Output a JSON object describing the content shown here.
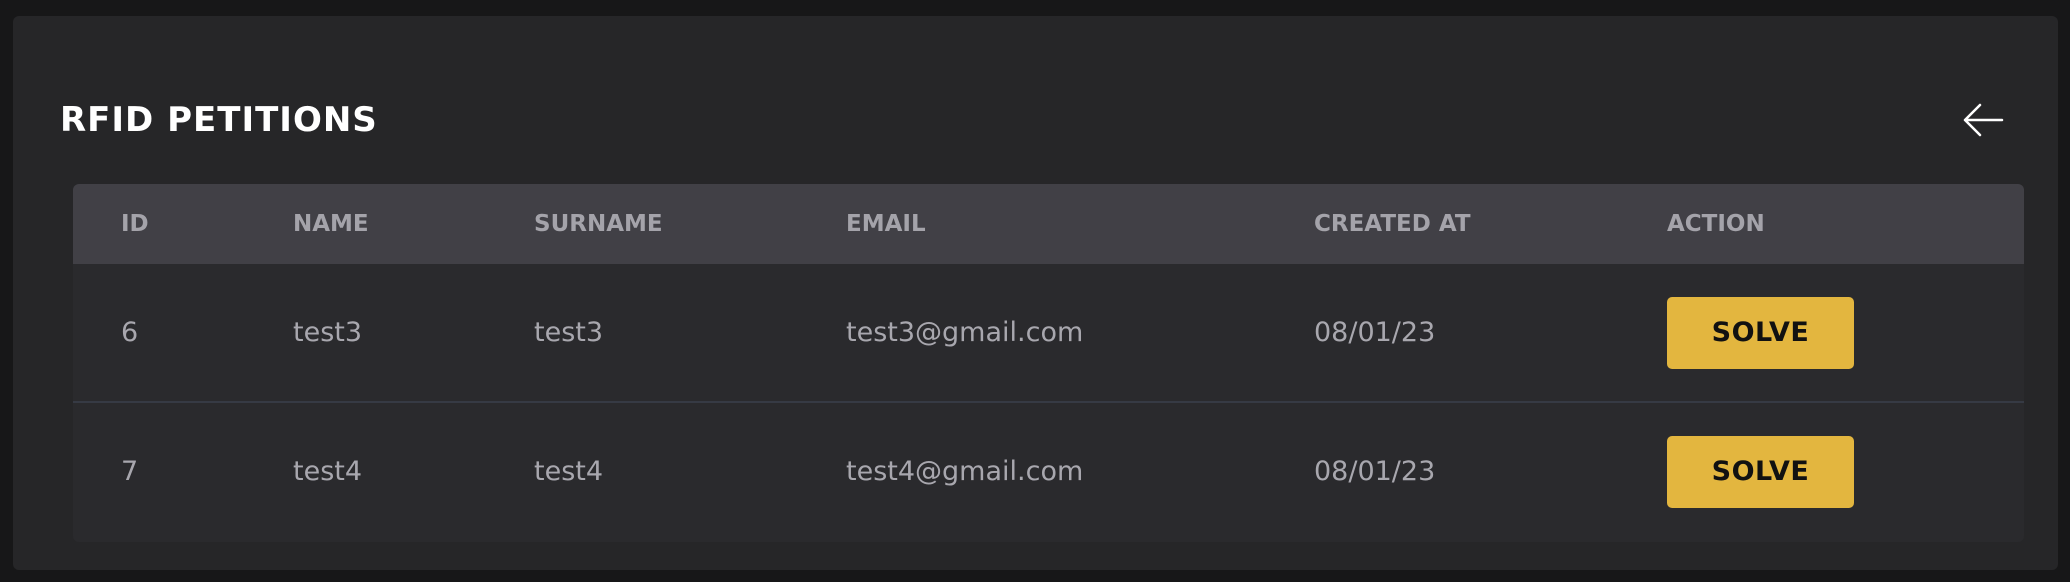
{
  "page": {
    "title": "RFID PETITIONS",
    "back_icon": "arrow-left-icon"
  },
  "table": {
    "headers": {
      "id": "ID",
      "name": "NAME",
      "surname": "SURNAME",
      "email": "EMAIL",
      "created_at": "CREATED AT",
      "action": "ACTION"
    },
    "rows": [
      {
        "id": "6",
        "name": "test3",
        "surname": "test3",
        "email": "test3@gmail.com",
        "created_at": "08/01/23",
        "action_label": "SOLVE"
      },
      {
        "id": "7",
        "name": "test4",
        "surname": "test4",
        "email": "test4@gmail.com",
        "created_at": "08/01/23",
        "action_label": "SOLVE"
      }
    ]
  },
  "colors": {
    "background": "#171718",
    "panel": "#262628",
    "header_row": "#414046",
    "accent_button": "#e3b63f"
  }
}
